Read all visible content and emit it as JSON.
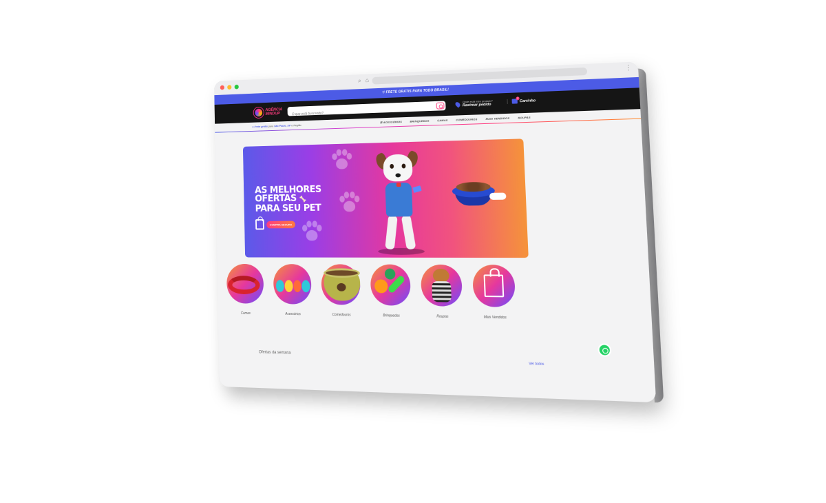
{
  "promo_bar": {
    "text": "FRETE GRÁTIS PARA TODO BRASIL!"
  },
  "header": {
    "logo_line1": "AGÊNCIA",
    "logo_line2": "MINDUP",
    "search_placeholder": "O que está buscando?",
    "track_small": "Onde está meu produto?",
    "track_label": "Rastrear pedido",
    "cart_label": "Carrinho",
    "cart_count": "0"
  },
  "subnav": {
    "ship_prefix": "Frete grátis",
    "ship_mid": "para",
    "ship_place": "São Paulo, SP",
    "ship_suffix": "e Região",
    "menu": [
      "Acessórios",
      "Brinquedos",
      "Camas",
      "Comedouros",
      "Mais Vendidos",
      "Roupas"
    ]
  },
  "banner": {
    "title_line1": "AS MELHORES",
    "title_line2": "OFERTAS",
    "title_line3": "PARA SEU PET",
    "cta": "COMPRA SEGURA"
  },
  "categories": [
    {
      "label": "Camas"
    },
    {
      "label": "Acessórios"
    },
    {
      "label": "Comedouros"
    },
    {
      "label": "Brinquedos"
    },
    {
      "label": "Roupas"
    },
    {
      "label": "Mais Vendidos"
    }
  ],
  "section": {
    "title": "Ofertas da semana",
    "link": "Ver todos"
  },
  "colors": {
    "accent": "#4c5be6",
    "pink": "#ff3d7f",
    "orange": "#f5933a",
    "dark": "#151515"
  }
}
